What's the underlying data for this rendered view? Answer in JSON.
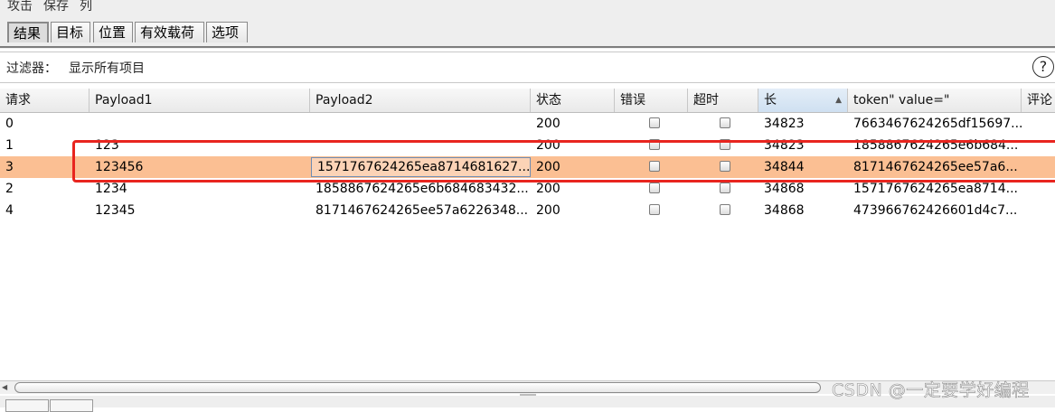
{
  "menu": [
    "攻击",
    "保存",
    "列"
  ],
  "tabs": [
    "结果",
    "目标",
    "位置",
    "有效载荷",
    "选项"
  ],
  "filter": {
    "label": "过滤器：",
    "value": "显示所有项目"
  },
  "help_icon": "?",
  "columns": [
    "请求",
    "Payload1",
    "Payload2",
    "状态",
    "错误",
    "超时",
    "长",
    "token\" value=\"",
    "评论"
  ],
  "sort_indicator": "▲",
  "rows": [
    {
      "req": "0",
      "p1": "",
      "p2": "",
      "status": "200",
      "error": false,
      "timeout": false,
      "len": "34823",
      "token": "7663467624265df15697...",
      "selected": false
    },
    {
      "req": "1",
      "p1": "123",
      "p2": "",
      "status": "200",
      "error": false,
      "timeout": false,
      "len": "34823",
      "token": "1858867624265e6b684...",
      "selected": false
    },
    {
      "req": "3",
      "p1": "123456",
      "p2": "1571767624265ea8714681627...",
      "status": "200",
      "error": false,
      "timeout": false,
      "len": "34844",
      "token": "8171467624265ee57a6...",
      "selected": true
    },
    {
      "req": "2",
      "p1": "1234",
      "p2": "1858867624265e6b684683432...",
      "status": "200",
      "error": false,
      "timeout": false,
      "len": "34868",
      "token": "1571767624265ea8714...",
      "selected": false
    },
    {
      "req": "4",
      "p1": "12345",
      "p2": "8171467624265ee57a6226348...",
      "status": "200",
      "error": false,
      "timeout": false,
      "len": "34868",
      "token": "473966762426601d4c7...",
      "selected": false
    }
  ],
  "watermark": "CSDN @一定要学好编程"
}
